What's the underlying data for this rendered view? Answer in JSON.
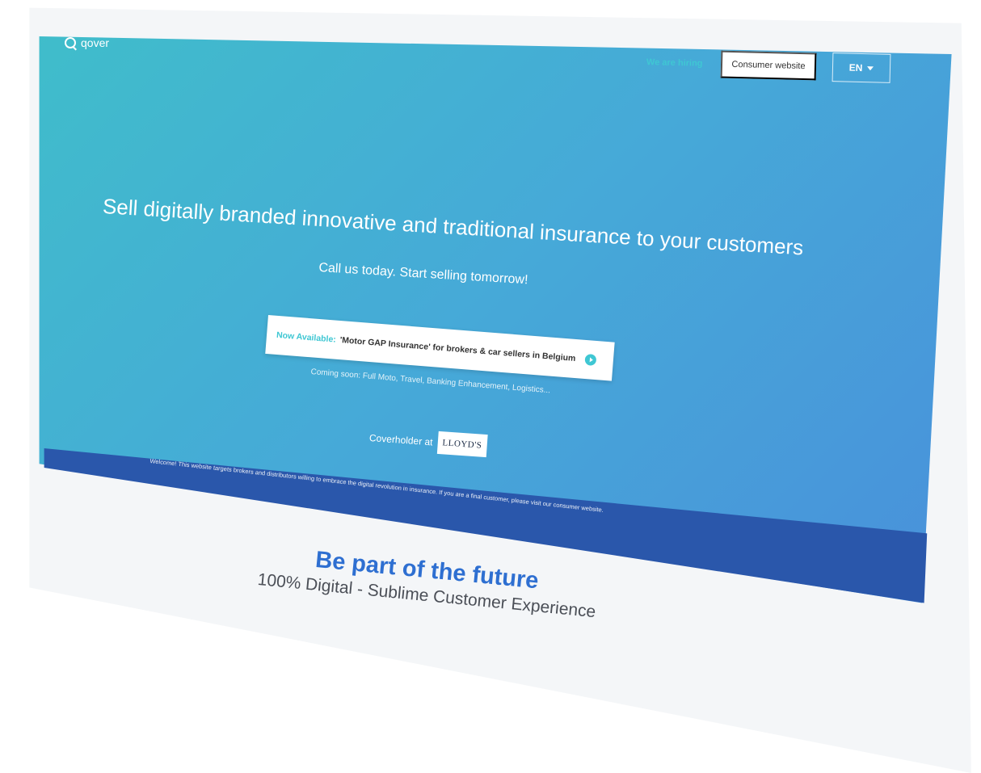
{
  "brand": {
    "name": "qover",
    "logo_icon": "q-ring-icon"
  },
  "nav": {
    "hiring_label": "We are hiring",
    "consumer_label": "Consumer website",
    "lang_label": "EN"
  },
  "hero": {
    "headline": "Sell digitally branded innovative and traditional insurance to your customers",
    "subheadline": "Call us today. Start selling tomorrow!",
    "banner_highlight": "Now Available:",
    "banner_text": "'Motor GAP Insurance' for brokers & car sellers in Belgium",
    "coming_soon": "Coming soon: Full Moto, Travel, Banking Enhancement, Logistics...",
    "coverholder_label": "Coverholder at",
    "lloyds_label": "LLOYD'S"
  },
  "notice": {
    "text": "Welcome! This website targets brokers and distributors willing to embrace the digital revolution in insurance. If you are a final customer, please visit our consumer website."
  },
  "section": {
    "title": "Be part of the future",
    "subtitle": "100% Digital - Sublime Customer Experience"
  },
  "colors": {
    "gradient_start": "#3fbfc9",
    "gradient_end": "#4a8adb",
    "band": "#2a57ab",
    "accent": "#3fc7d3",
    "title_blue": "#2e6fd1"
  }
}
